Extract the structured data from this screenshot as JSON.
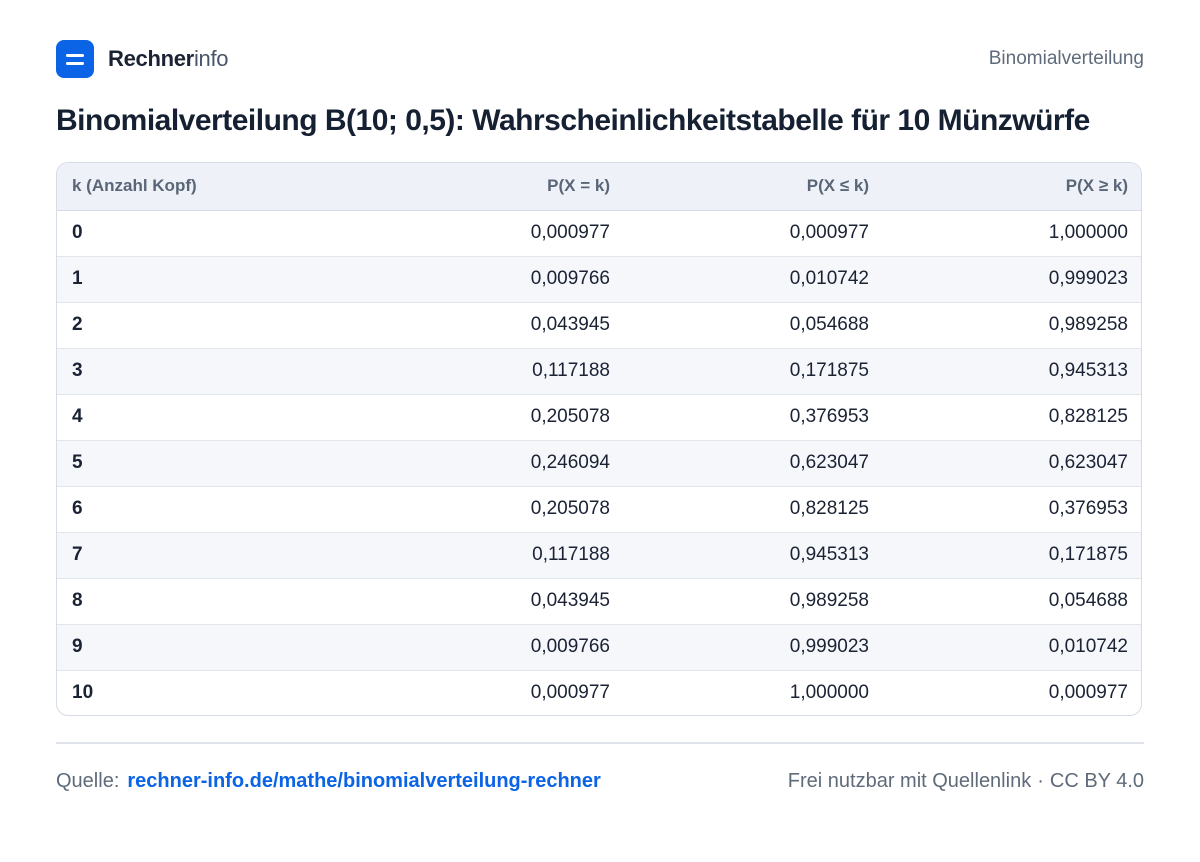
{
  "header": {
    "brand_bold": "Rechner",
    "brand_light": "info",
    "section": "Binomialverteilung"
  },
  "title": "Binomialverteilung B(10; 0,5): Wahrscheinlichkeitstabelle für 10 Münzwürfe",
  "table": {
    "columns": [
      "k (Anzahl Kopf)",
      "P(X = k)",
      "P(X ≤ k)",
      "P(X ≥ k)"
    ],
    "rows": [
      [
        "0",
        "0,000977",
        "0,000977",
        "1,000000"
      ],
      [
        "1",
        "0,009766",
        "0,010742",
        "0,999023"
      ],
      [
        "2",
        "0,043945",
        "0,054688",
        "0,989258"
      ],
      [
        "3",
        "0,117188",
        "0,171875",
        "0,945313"
      ],
      [
        "4",
        "0,205078",
        "0,376953",
        "0,828125"
      ],
      [
        "5",
        "0,246094",
        "0,623047",
        "0,623047"
      ],
      [
        "6",
        "0,205078",
        "0,828125",
        "0,376953"
      ],
      [
        "7",
        "0,117188",
        "0,945313",
        "0,171875"
      ],
      [
        "8",
        "0,043945",
        "0,989258",
        "0,054688"
      ],
      [
        "9",
        "0,009766",
        "0,999023",
        "0,010742"
      ],
      [
        "10",
        "0,000977",
        "1,000000",
        "0,000977"
      ]
    ]
  },
  "footer": {
    "source_label": "Quelle:",
    "source_link": "rechner-info.de/mathe/binomialverteilung-rechner",
    "license_text": "Frei nutzbar mit Quellenlink",
    "separator": "·",
    "license": "CC BY 4.0"
  },
  "colors": {
    "accent": "#0b63e5",
    "header_bg": "#eef2f8",
    "row_alt_bg": "#f5f7fb"
  }
}
